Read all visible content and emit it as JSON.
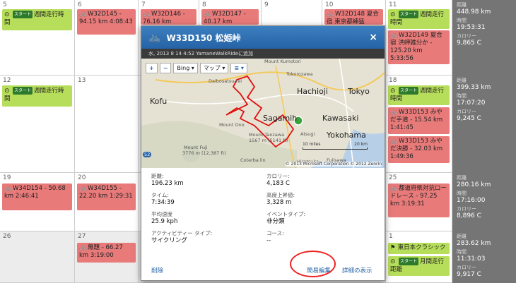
{
  "calendar": {
    "row1": {
      "days": [
        "5",
        "6",
        "7",
        "8",
        "9",
        "10",
        "11"
      ],
      "events": {
        "d5": {
          "badge": "スタート",
          "text": "週間走行時間"
        },
        "d6": {
          "text": "W32D145 - 94.15 km 4:08:43"
        },
        "d7": {
          "text": "W32D146 - 76.16 km"
        },
        "d8": {
          "text": "W32D147 - 40.17 km"
        },
        "d10": {
          "text": "W32D148 夏合宿 東京都練猛"
        },
        "d11a": {
          "badge": "スタート",
          "text": "週間走行時間"
        },
        "d11b": {
          "text": "W32D149 夏合宿 洪岬雑分か - 125.20 km 5:33:56"
        }
      },
      "summary": {
        "l1": "距離",
        "v1": "448.98 km",
        "l2": "時間",
        "v2": "19:53:31",
        "l3": "カロリー",
        "v3": "9,865 C"
      }
    },
    "row2": {
      "days": [
        "12",
        "13",
        "18"
      ],
      "events": {
        "d12": {
          "badge": "スタート",
          "text": "週間走行時間"
        },
        "d18a": {
          "badge": "スタート",
          "text": "週間走行時間"
        },
        "d18b": {
          "text": "W33D153 みやだ手道 - 15.54 km 1:41:45"
        },
        "d18c": {
          "text": "W33D153 みやだ決勝 - 32.03 km 1:49:36"
        }
      },
      "summary": {
        "l1": "距離",
        "v1": "399.33 km",
        "l2": "時間",
        "v2": "17:07:20",
        "l3": "カロリー",
        "v3": "9,245 C"
      }
    },
    "row3": {
      "days": [
        "19",
        "20",
        "25"
      ],
      "events": {
        "d19": {
          "text": "W34D154 - 50.68 km 2:46:41"
        },
        "d20": {
          "text": "W34D155 - 22.20 km 1:29:31"
        },
        "d25": {
          "text": "都道府県対抗ロードレース - 97.25 km 3:19:31"
        }
      },
      "summary": {
        "l1": "距離",
        "v1": "280.16 km",
        "l2": "時間",
        "v2": "17:16:00",
        "l3": "カロリー",
        "v3": "8,896 C"
      }
    },
    "row4": {
      "days": [
        "26",
        "27",
        "1"
      ],
      "events": {
        "d27": {
          "text": "無題 - 66.27 km 3:19:00"
        },
        "d1a": {
          "text": "東日本クラシック"
        },
        "d1b": {
          "badge": "スタート",
          "text": "月間走行距離"
        }
      },
      "summary": {
        "l1": "距離",
        "v1": "283.62 km",
        "l2": "時間",
        "v2": "11:31:03",
        "l3": "カロリー",
        "v3": "9,917 C"
      }
    }
  },
  "modal": {
    "title": "W33D150 松姫峠",
    "subtitle": "水, 2013 8 14 4:52 YamaneWalkRideに追加",
    "close": "×",
    "map": {
      "zoom_in": "+",
      "zoom_out": "−",
      "bing": "Bing ▾",
      "map_type": "マップ ▾",
      "layers": "≡ ▾",
      "labels": {
        "kofu": "Kofu",
        "hachioji": "Hachioji",
        "tokyo": "Tokyo",
        "kawasaki": "Kawasaki",
        "yokohama": "Yokohama",
        "sagamihara": "Sagamih",
        "tokorozawa": "Tokorozawa",
        "mount_kumotori": "Mount Kumotori",
        "daibosatsu": "Daibosatsu-rei",
        "mount_ono": "Mount Ono",
        "mount_tanzawa": "Mount Tanzawa",
        "tanzawa_height": "1567 m (5141 ft)",
        "mount_fuji": "Mount Fuji",
        "fuji_height": "3776 m (12,387 ft)",
        "atsugi": "Atsugi",
        "hiratsuka": "Hiratsuka",
        "fujisawa": "Fujisawa",
        "coterba": "Coterba lin",
        "scale_miles": "10 miles",
        "scale_km": "20 km",
        "route52": "52"
      },
      "copyright": "© 2013 Microsoft Corporation  © 2012 Zenrin"
    },
    "details": {
      "distance_label": "距離:",
      "distance": "196.23 km",
      "calories_label": "カロリー:",
      "calories": "4,183 C",
      "time_label": "タイム:",
      "time": "7:34:39",
      "elev_label": "高度上昇値:",
      "elev": "3,328 m",
      "speed_label": "平均速度",
      "speed": "25.9 kph",
      "event_type_label": "イベントタイプ:",
      "event_type": "非分類",
      "activity_label": "アクティビティー タイプ:",
      "activity": "サイクリング",
      "course_label": "コース:",
      "course": "--"
    },
    "actions": {
      "delete": "削除",
      "quick_edit": "簡易編集",
      "view_details": "詳細の表示"
    }
  }
}
